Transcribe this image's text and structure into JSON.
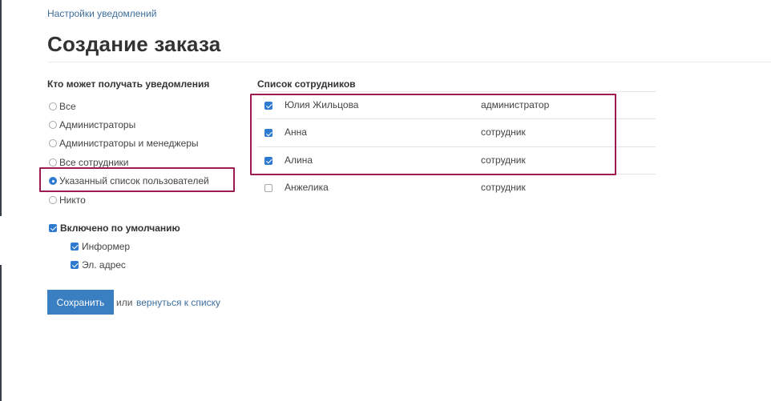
{
  "breadcrumb": "Настройки уведомлений",
  "page_title": "Создание заказа",
  "recipients": {
    "heading": "Кто может получать уведомления",
    "options": [
      {
        "label": "Все",
        "selected": false
      },
      {
        "label": "Администраторы",
        "selected": false
      },
      {
        "label": "Администраторы и менеджеры",
        "selected": false
      },
      {
        "label": "Все сотрудники",
        "selected": false
      },
      {
        "label": "Указанный список пользователей",
        "selected": true
      },
      {
        "label": "Никто",
        "selected": false
      }
    ]
  },
  "defaults": {
    "enabled_label": "Включено по умолчанию",
    "enabled_checked": true,
    "channels": [
      {
        "label": "Информер",
        "checked": true
      },
      {
        "label": "Эл. адрес",
        "checked": true
      }
    ]
  },
  "employees": {
    "heading": "Список сотрудников",
    "rows": [
      {
        "name": "Юлия Жильцова",
        "role": "администратор",
        "checked": true
      },
      {
        "name": "Анна",
        "role": "сотрудник",
        "checked": true
      },
      {
        "name": "Алина",
        "role": "сотрудник",
        "checked": true
      },
      {
        "name": "Анжелика",
        "role": "сотрудник",
        "checked": false
      }
    ]
  },
  "actions": {
    "save_label": "Сохранить",
    "or_text": "или",
    "back_link": "вернуться к списку"
  },
  "colors": {
    "accent": "#3a7fc1",
    "link": "#3d6e9e",
    "highlight": "#9b1b52"
  }
}
